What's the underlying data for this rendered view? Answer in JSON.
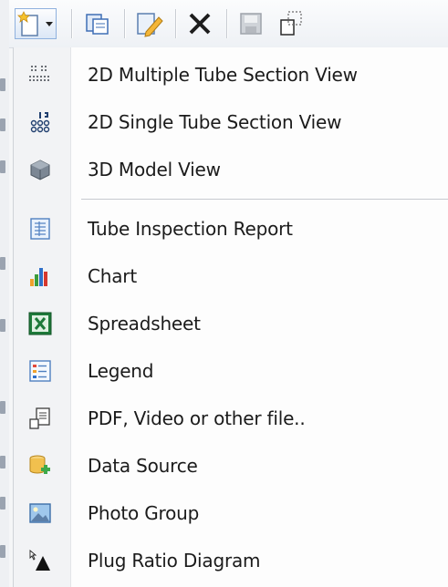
{
  "toolbar": {
    "icons": [
      "new-view-icon",
      "copy-icon",
      "edit-icon",
      "delete-icon",
      "save-icon",
      "select-area-icon"
    ]
  },
  "menu": {
    "groups": [
      {
        "items": [
          {
            "label": "2D Multiple Tube Section View",
            "icon": "multiple-tube-section-icon"
          },
          {
            "label": "2D Single Tube Section View",
            "icon": "single-tube-section-icon"
          },
          {
            "label": "3D Model View",
            "icon": "3d-model-icon"
          }
        ]
      },
      {
        "items": [
          {
            "label": "Tube Inspection Report",
            "icon": "report-icon"
          },
          {
            "label": "Chart",
            "icon": "bar-chart-icon"
          },
          {
            "label": "Spreadsheet",
            "icon": "spreadsheet-icon"
          },
          {
            "label": "Legend",
            "icon": "legend-icon"
          },
          {
            "label": "PDF, Video or other file..",
            "icon": "file-icon"
          },
          {
            "label": "Data Source",
            "icon": "data-source-icon"
          },
          {
            "label": "Photo Group",
            "icon": "photo-icon"
          },
          {
            "label": "Plug Ratio Diagram",
            "icon": "plug-ratio-icon"
          }
        ]
      }
    ]
  }
}
